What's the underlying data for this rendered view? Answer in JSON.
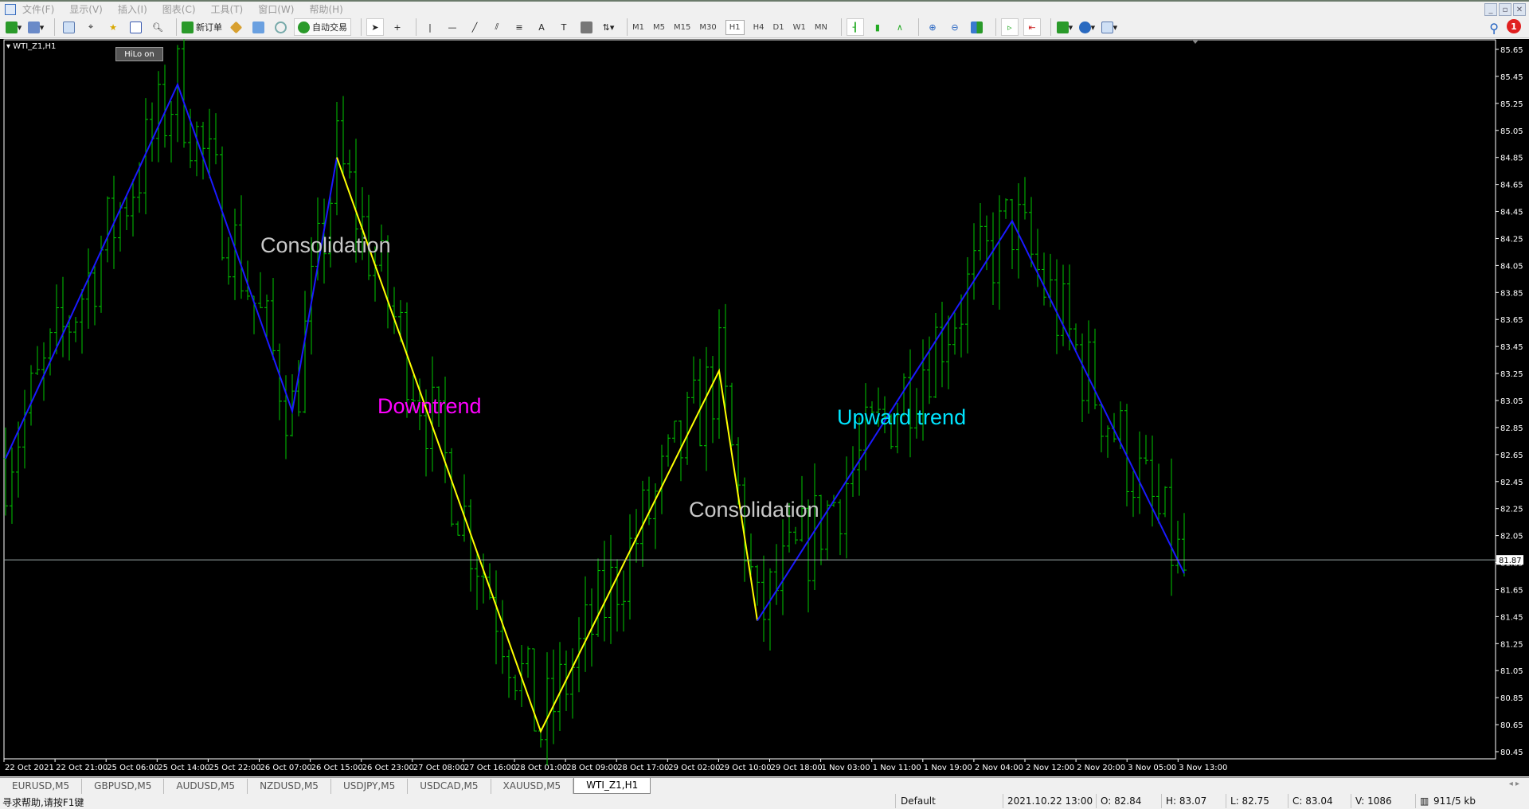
{
  "menu": [
    "文件(F)",
    "显示(V)",
    "插入(I)",
    "图表(C)",
    "工具(T)",
    "窗口(W)",
    "帮助(H)"
  ],
  "toolbar": {
    "new_order": "新订单",
    "auto_trading": "自动交易",
    "timeframes": [
      "M1",
      "M5",
      "M15",
      "M30",
      "H1",
      "H4",
      "D1",
      "W1",
      "MN"
    ],
    "active_timeframe": "H1",
    "notification_count": "1"
  },
  "chart": {
    "symbol_label": "WTI_Z1,H1",
    "hilo_button": "HiLo on",
    "current_price": "81.87",
    "annotations": [
      {
        "text": "Consolidation",
        "color": "#c8c8c8"
      },
      {
        "text": "Downtrend",
        "color": "#ff00ff"
      },
      {
        "text": "Consolidation",
        "color": "#c8c8c8"
      },
      {
        "text": "Upward trend",
        "color": "#00e5ff"
      }
    ]
  },
  "chart_data": {
    "type": "ohlc-bar",
    "symbol": "WTI_Z1",
    "timeframe": "H1",
    "ylim": [
      80.45,
      85.65
    ],
    "price_ticks": [
      "85.65",
      "85.45",
      "85.25",
      "85.05",
      "84.85",
      "84.65",
      "84.45",
      "84.25",
      "84.05",
      "83.85",
      "83.65",
      "83.45",
      "83.25",
      "83.05",
      "82.85",
      "82.65",
      "82.45",
      "82.25",
      "82.05",
      "81.85",
      "81.65",
      "81.45",
      "81.25",
      "81.05",
      "80.85",
      "80.65",
      "80.45"
    ],
    "time_ticks": [
      "22 Oct 2021",
      "22 Oct 21:00",
      "25 Oct 06:00",
      "25 Oct 14:00",
      "25 Oct 22:00",
      "26 Oct 07:00",
      "26 Oct 15:00",
      "26 Oct 23:00",
      "27 Oct 08:00",
      "27 Oct 16:00",
      "28 Oct 01:00",
      "28 Oct 09:00",
      "28 Oct 17:00",
      "29 Oct 02:00",
      "29 Oct 10:00",
      "29 Oct 18:00",
      "1 Nov 03:00",
      "1 Nov 11:00",
      "1 Nov 19:00",
      "2 Nov 04:00",
      "2 Nov 12:00",
      "2 Nov 20:00",
      "3 Nov 05:00",
      "3 Nov 13:00"
    ],
    "bar_count": 186,
    "zigzag_blue_1": [
      {
        "bar": 0,
        "price": 82.62
      },
      {
        "bar": 27,
        "price": 85.39
      },
      {
        "bar": 45,
        "price": 82.97
      },
      {
        "bar": 52,
        "price": 84.85
      }
    ],
    "zigzag_yellow": [
      {
        "bar": 52,
        "price": 84.85
      },
      {
        "bar": 84,
        "price": 80.6
      },
      {
        "bar": 112,
        "price": 83.27
      },
      {
        "bar": 118,
        "price": 81.42
      }
    ],
    "zigzag_blue_2": [
      {
        "bar": 118,
        "price": 81.42
      },
      {
        "bar": 158,
        "price": 84.38
      },
      {
        "bar": 185,
        "price": 81.77
      }
    ],
    "colors": {
      "bars": "#00c800",
      "zigzag_blue": "#1a1aff",
      "zigzag_yellow": "#ffff00",
      "bid_line": "#9aa6a6"
    }
  },
  "tabs": [
    "EURUSD,M5",
    "GBPUSD,M5",
    "AUDUSD,M5",
    "NZDUSD,M5",
    "USDJPY,M5",
    "USDCAD,M5",
    "XAUUSD,M5",
    "WTI_Z1,H1"
  ],
  "active_tab": "WTI_Z1,H1",
  "status": {
    "help": "寻求帮助,请按F1键",
    "profile": "Default",
    "datetime": "2021.10.22 13:00",
    "open": "O: 82.84",
    "high": "H: 83.07",
    "low": "L: 82.75",
    "close": "C: 83.04",
    "volume": "V: 1086",
    "traffic": "911/5 kb"
  }
}
